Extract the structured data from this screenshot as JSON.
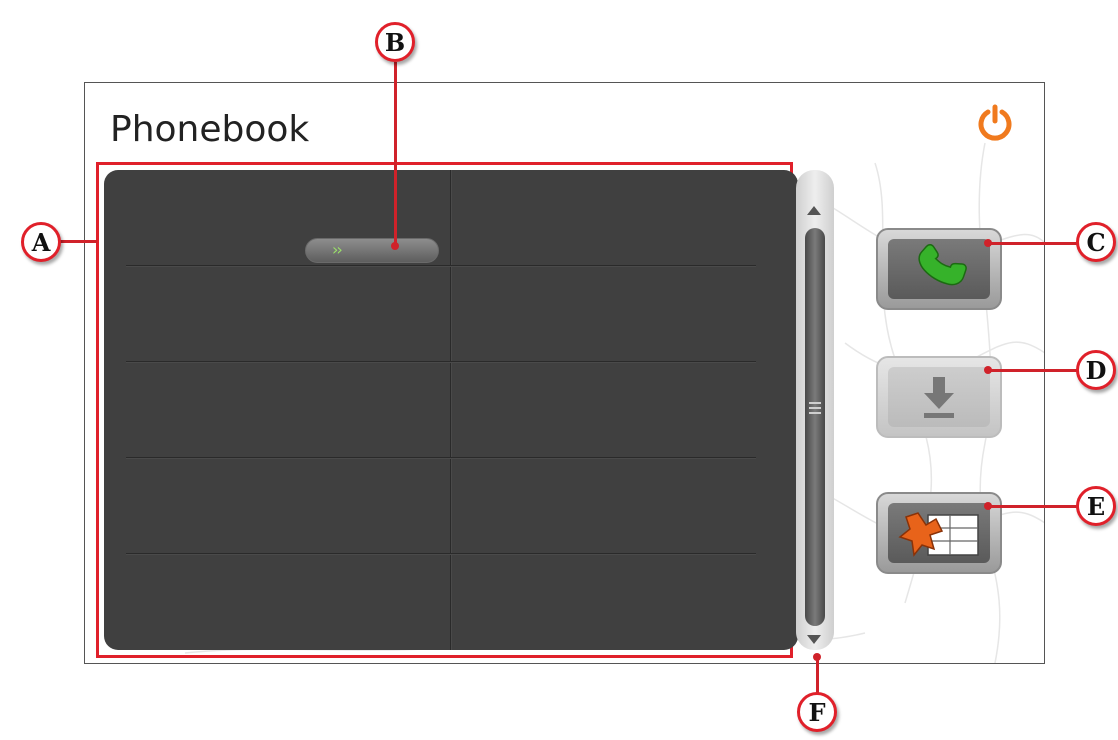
{
  "app": {
    "title": "Phonebook"
  },
  "icons": {
    "power": "power-icon",
    "call": "phone-handset-icon",
    "save": "download-arrow-icon",
    "delete": "delete-entry-icon",
    "scroll_up": "arrow-up-icon",
    "scroll_down": "arrow-down-icon",
    "scroll_grip": "grip-icon",
    "row_chevrons": "double-chevron-icon"
  },
  "contact_list": {
    "columns": [
      "",
      ""
    ],
    "rows": [
      [
        "",
        ""
      ],
      [
        "",
        ""
      ],
      [
        "",
        ""
      ],
      [
        "",
        ""
      ],
      [
        "",
        ""
      ]
    ],
    "scroll_indicator_glyph": "»"
  },
  "callouts": [
    {
      "letter": "A",
      "target": "contact-list"
    },
    {
      "letter": "B",
      "target": "row-selector"
    },
    {
      "letter": "C",
      "target": "call-button"
    },
    {
      "letter": "D",
      "target": "save-button"
    },
    {
      "letter": "E",
      "target": "delete-button"
    },
    {
      "letter": "F",
      "target": "scrollbar"
    }
  ],
  "colors": {
    "accent_power": "#f07a1e",
    "callout_red": "#e0202a",
    "list_bg": "#404040",
    "call_green": "#36b22a",
    "delete_orange": "#e8631a"
  }
}
